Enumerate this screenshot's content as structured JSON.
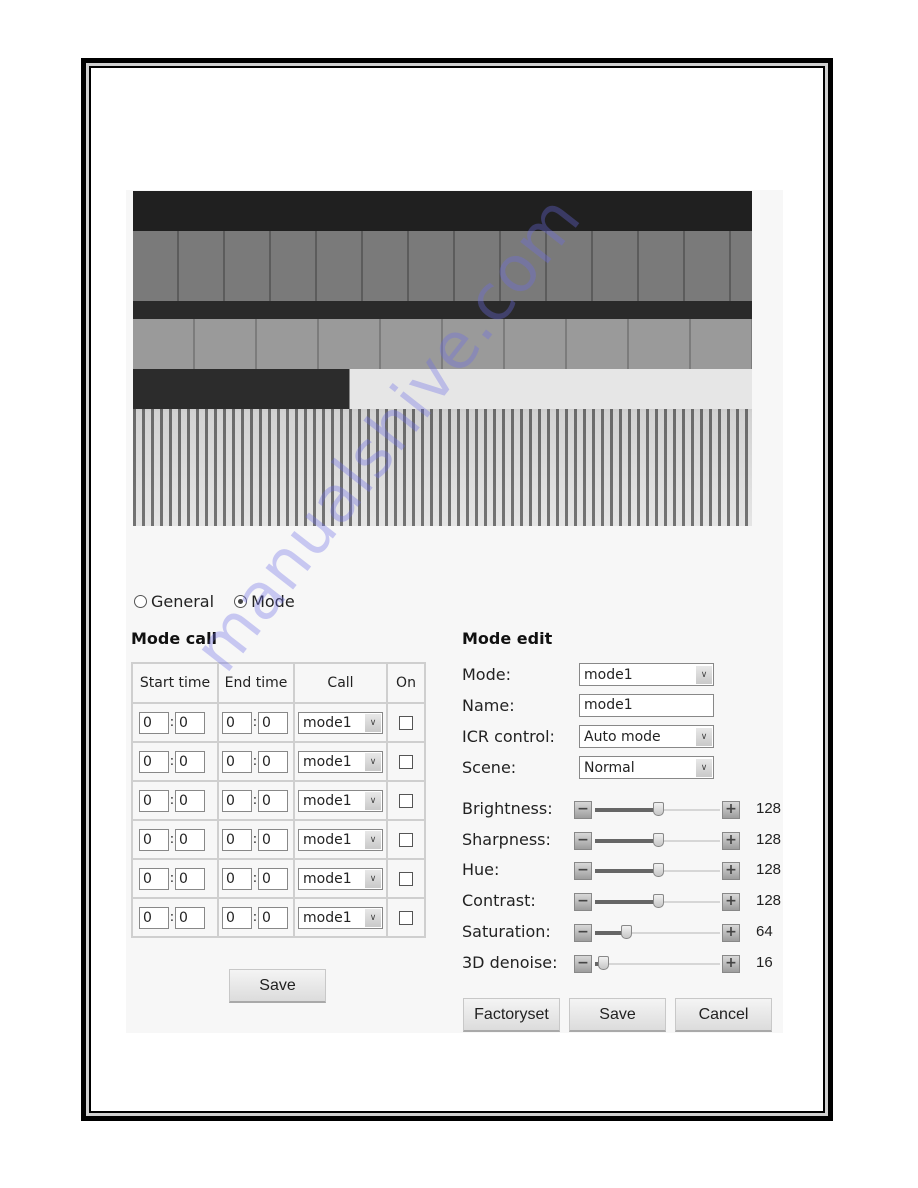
{
  "view_mode": {
    "options": [
      {
        "label": "General",
        "selected": false
      },
      {
        "label": "Mode",
        "selected": true
      }
    ]
  },
  "mode_call": {
    "title": "Mode call",
    "columns": [
      "Start time",
      "End time",
      "Call",
      "On"
    ],
    "rows": [
      {
        "start_h": "0",
        "start_m": "0",
        "end_h": "0",
        "end_m": "0",
        "call": "mode1",
        "on": false
      },
      {
        "start_h": "0",
        "start_m": "0",
        "end_h": "0",
        "end_m": "0",
        "call": "mode1",
        "on": false
      },
      {
        "start_h": "0",
        "start_m": "0",
        "end_h": "0",
        "end_m": "0",
        "call": "mode1",
        "on": false
      },
      {
        "start_h": "0",
        "start_m": "0",
        "end_h": "0",
        "end_m": "0",
        "call": "mode1",
        "on": false
      },
      {
        "start_h": "0",
        "start_m": "0",
        "end_h": "0",
        "end_m": "0",
        "call": "mode1",
        "on": false
      },
      {
        "start_h": "0",
        "start_m": "0",
        "end_h": "0",
        "end_m": "0",
        "call": "mode1",
        "on": false
      }
    ],
    "time_separator": ":",
    "save_label": "Save"
  },
  "mode_edit": {
    "title": "Mode edit",
    "mode_label": "Mode:",
    "mode_value": "mode1",
    "name_label": "Name:",
    "name_value": "mode1",
    "icr_label": "ICR control:",
    "icr_value": "Auto mode",
    "scene_label": "Scene:",
    "scene_value": "Normal",
    "slider_min": 0,
    "slider_max": 255,
    "sliders": [
      {
        "label": "Brightness:",
        "value": 128
      },
      {
        "label": "Sharpness:",
        "value": 128
      },
      {
        "label": "Hue:",
        "value": 128
      },
      {
        "label": "Contrast:",
        "value": 128
      },
      {
        "label": "Saturation:",
        "value": 64
      },
      {
        "label": "3D denoise:",
        "value": 16
      }
    ],
    "factoryset_label": "Factoryset",
    "save_label": "Save",
    "cancel_label": "Cancel"
  },
  "icons": {
    "decrease": "−",
    "increase": "+",
    "dropdown": "∨"
  },
  "watermark": "manualshive.com"
}
